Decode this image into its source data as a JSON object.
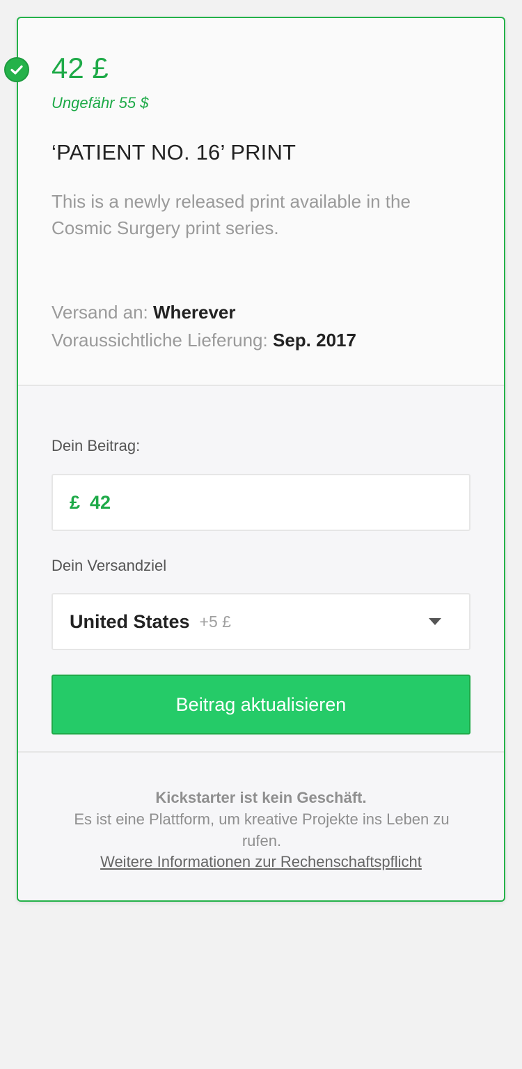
{
  "reward": {
    "price": "42 £",
    "approx": "Ungefähr 55 $",
    "title": "‘PATIENT NO. 16’ PRINT",
    "description": "This is a newly released print available in the Cosmic Surgery print series.",
    "ships_to_label": "Versand an:",
    "ships_to_value": "Wherever",
    "delivery_label": "Voraussichtliche Lieferung:",
    "delivery_value": "Sep. 2017",
    "selected_icon": "check-circle-icon"
  },
  "pledge": {
    "amount_label": "Dein Beitrag:",
    "currency": "£",
    "amount_value": "42",
    "shipping_label": "Dein Versandziel",
    "shipping_country": "United States",
    "shipping_surcharge": "+5 £",
    "dropdown_icon": "caret-down-icon",
    "update_button": "Beitrag aktualisieren"
  },
  "footer": {
    "headline": "Kickstarter ist kein Geschäft.",
    "text": "Es ist eine Plattform, um kreative Projekte ins Leben zu rufen.",
    "link": "Weitere Informationen zur Rechenschaftspflicht"
  },
  "colors": {
    "accent_green": "#1eaa48",
    "button_green": "#25cb68"
  }
}
